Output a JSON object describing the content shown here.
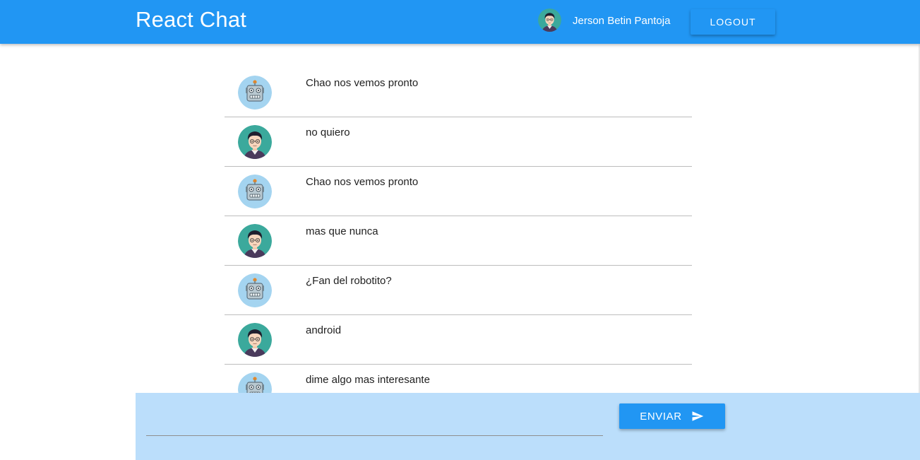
{
  "header": {
    "title": "React Chat",
    "user_name": "Jerson Betin Pantoja",
    "logout_label": "LOGOUT",
    "bar_color": "#2196f3"
  },
  "messages": [
    {
      "author": "bot",
      "avatar": "robot-avatar",
      "text": "Chao nos vemos pronto"
    },
    {
      "author": "user",
      "avatar": "user-avatar",
      "text": "no quiero"
    },
    {
      "author": "bot",
      "avatar": "robot-avatar",
      "text": "Chao nos vemos pronto"
    },
    {
      "author": "user",
      "avatar": "user-avatar",
      "text": "mas que nunca"
    },
    {
      "author": "bot",
      "avatar": "robot-avatar",
      "text": "¿Fan del robotito?"
    },
    {
      "author": "user",
      "avatar": "user-avatar",
      "text": "android"
    },
    {
      "author": "bot",
      "avatar": "robot-avatar",
      "text": "dime algo mas interesante"
    }
  ],
  "composer": {
    "input_value": "",
    "send_label": "ENVIAR",
    "send_icon": "send-icon",
    "background": "#bbdefb"
  }
}
